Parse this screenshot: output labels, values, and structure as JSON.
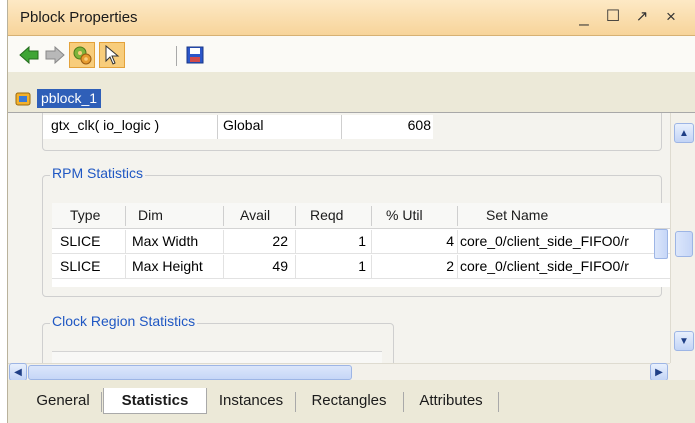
{
  "window": {
    "title": "Pblock Properties",
    "controls": [
      "_",
      "☐",
      "↗",
      "×"
    ]
  },
  "toolbar": {
    "buttons": [
      {
        "name": "back",
        "icon": "arrow-left-icon",
        "color": "#3fa535"
      },
      {
        "name": "forward",
        "icon": "arrow-right-icon",
        "color": "#a0a0a0"
      },
      {
        "name": "auto-update",
        "icon": "gears-icon",
        "active": true
      },
      {
        "name": "select",
        "icon": "cursor-icon",
        "active": true
      },
      {
        "name": "save",
        "icon": "save-icon"
      }
    ]
  },
  "object": {
    "name": "pblock_1",
    "icon": "pblock-icon"
  },
  "top_table": {
    "cells": [
      "gtx_clk( io_logic )",
      "Global",
      "608"
    ]
  },
  "rpm": {
    "title": "RPM Statistics",
    "columns": [
      "Type",
      "Dim",
      "Avail",
      "Reqd",
      "% Util",
      "Set Name"
    ],
    "rows": [
      [
        "SLICE",
        "Max Width",
        "22",
        "1",
        "4",
        "core_0/client_side_FIFO0/r"
      ],
      [
        "SLICE",
        "Max Height",
        "49",
        "1",
        "2",
        "core_0/client_side_FIFO0/r"
      ]
    ]
  },
  "clock": {
    "title": "Clock Region Statistics"
  },
  "tabs": [
    {
      "label": "General",
      "selected": false
    },
    {
      "label": "Statistics",
      "selected": true
    },
    {
      "label": "Instances",
      "selected": false
    },
    {
      "label": "Rectangles",
      "selected": false
    },
    {
      "label": "Attributes",
      "selected": false
    }
  ],
  "colors": {
    "titlebar": "#f7d49a",
    "selection": "#2f5fb8",
    "legend": "#1f57c3"
  }
}
